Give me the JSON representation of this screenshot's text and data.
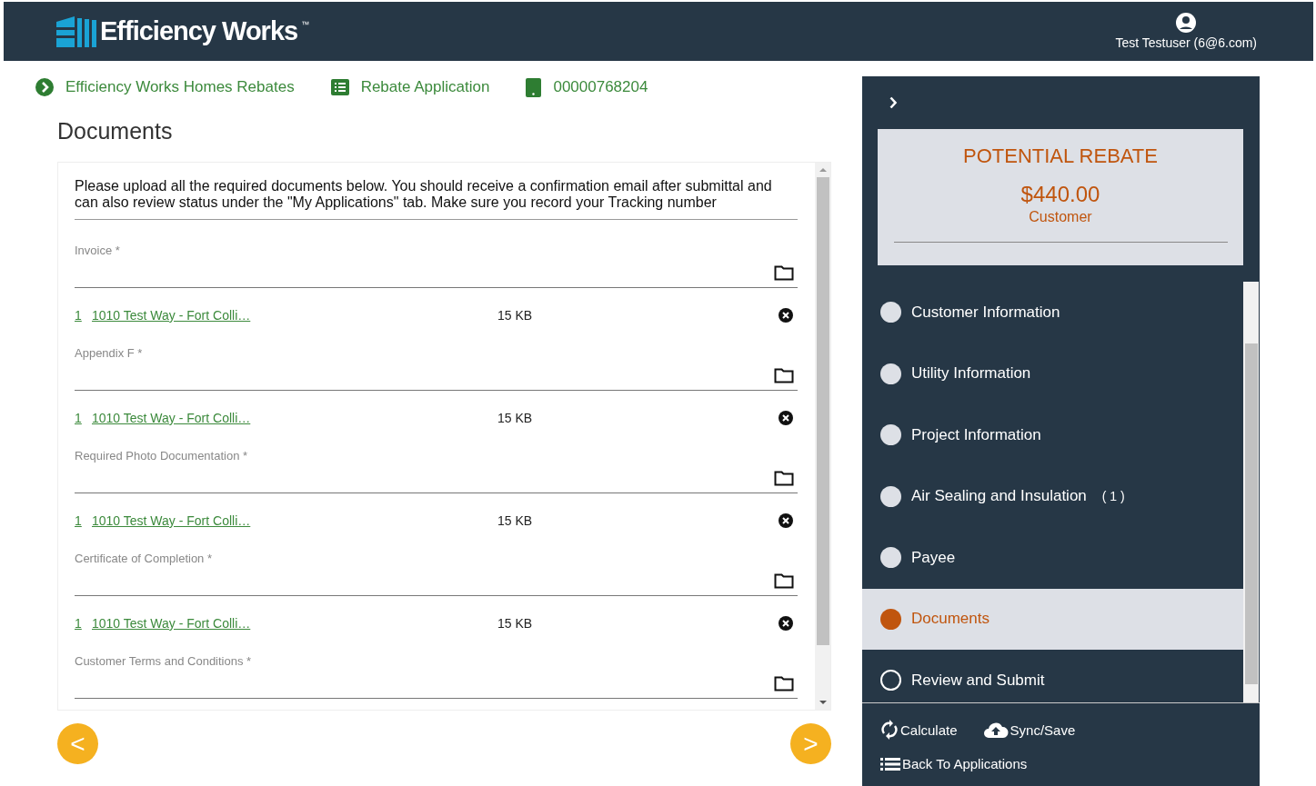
{
  "header": {
    "brand": "Efficiency Works",
    "trademark": "™",
    "user": "Test Testuser (6@6.com)"
  },
  "breadcrumbs": [
    {
      "kind": "program",
      "label": "Efficiency Works Homes Rebates"
    },
    {
      "kind": "form",
      "label": "Rebate Application"
    },
    {
      "kind": "record",
      "label": "00000768204"
    }
  ],
  "page_title": "Documents",
  "intro": "Please upload all the required documents below. You should receive a confirmation email after submittal and can also review status under the \"My Applications\" tab. Make sure you record your Tracking number",
  "upload_fields": [
    {
      "label": "Invoice *",
      "files": [
        {
          "index": "1",
          "name": "1010 Test Way - Fort Colli…",
          "size": "15 KB"
        }
      ]
    },
    {
      "label": "Appendix F *",
      "files": [
        {
          "index": "1",
          "name": "1010 Test Way - Fort Colli…",
          "size": "15 KB"
        }
      ]
    },
    {
      "label": "Required Photo Documentation *",
      "files": [
        {
          "index": "1",
          "name": "1010 Test Way - Fort Colli…",
          "size": "15 KB"
        }
      ]
    },
    {
      "label": "Certificate of Completion *",
      "files": [
        {
          "index": "1",
          "name": "1010 Test Way - Fort Colli…",
          "size": "15 KB"
        }
      ]
    },
    {
      "label": "Customer Terms and Conditions *"
    }
  ],
  "nav": {
    "back": "<",
    "next": ">"
  },
  "rebate": {
    "title": "POTENTIAL REBATE",
    "amount": "$440.00",
    "recipient": "Customer"
  },
  "steps": [
    {
      "label": "Customer Information",
      "kind": "done",
      "selected": false
    },
    {
      "label": "Utility Information",
      "kind": "done",
      "selected": false
    },
    {
      "label": "Project Information",
      "kind": "done",
      "selected": false
    },
    {
      "label": "Air Sealing and Insulation",
      "count": "( 1 )",
      "kind": "done",
      "selected": false
    },
    {
      "label": "Payee",
      "kind": "done",
      "selected": false
    },
    {
      "label": "Documents",
      "kind": "current",
      "selected": true
    },
    {
      "label": "Review and Submit",
      "kind": "todo",
      "selected": false
    }
  ],
  "actions": [
    {
      "kind": "calculate",
      "label": "Calculate"
    },
    {
      "kind": "sync",
      "label": "Sync/Save"
    },
    {
      "kind": "back",
      "label": "Back To Applications"
    }
  ]
}
